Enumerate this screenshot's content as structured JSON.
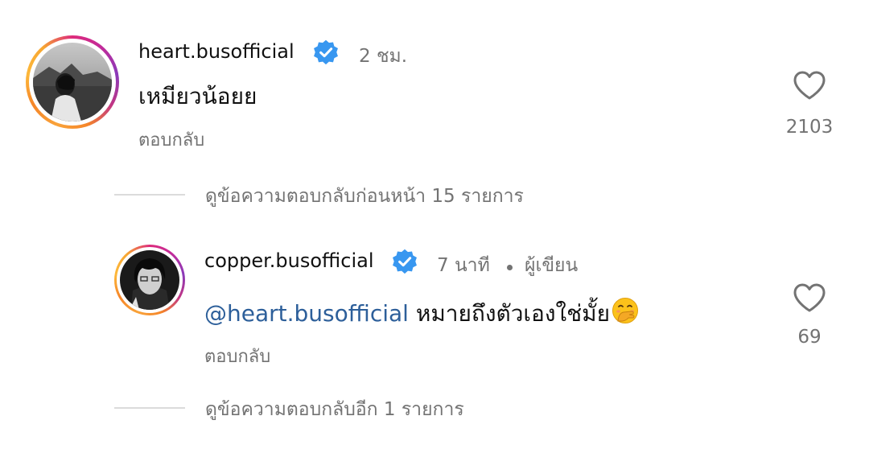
{
  "comments": [
    {
      "username": "heart.busofficial",
      "verified": true,
      "time": "2 ชม.",
      "text": "เหมียวน้อยย",
      "reply_label": "ตอบกลับ",
      "likes": "2103",
      "view_replies": "ดูข้อความตอบกลับก่อนหน้า 15 รายการ"
    },
    {
      "username": "copper.busofficial",
      "verified": true,
      "time": "7 นาที",
      "author_label": "ผู้เขียน",
      "mention": "@heart.busofficial",
      "text": "หมายถึงตัวเองใช่มั้ย",
      "emoji": "face-with-hand-over-mouth",
      "reply_label": "ตอบกลับ",
      "likes": "69",
      "view_replies": "ดูข้อความตอบกลับอีก 1 รายการ"
    }
  ],
  "colors": {
    "verified": "#3897f0",
    "mention": "#2d5f9a",
    "muted": "#737373",
    "divider": "#dbdbdb"
  }
}
